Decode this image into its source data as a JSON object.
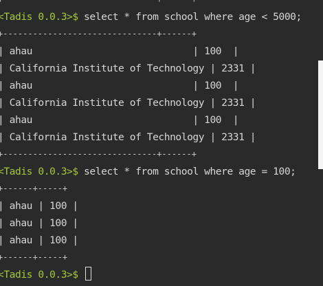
{
  "terminal": {
    "lines": [
      {
        "kind": "border",
        "text": "+-------------------------------+------+"
      },
      {
        "kind": "command",
        "prompt": "<Tadis 0.0.3>$",
        "text": " select * from school where age < 5000;"
      },
      {
        "kind": "border",
        "text": "+-------------------------------+------+"
      },
      {
        "kind": "row",
        "text": "| ahau                            | 100  |"
      },
      {
        "kind": "row",
        "text": "| California Institute of Technology | 2331 |"
      },
      {
        "kind": "row",
        "text": "| ahau                            | 100  |"
      },
      {
        "kind": "row",
        "text": "| California Institute of Technology | 2331 |"
      },
      {
        "kind": "row",
        "text": "| ahau                            | 100  |"
      },
      {
        "kind": "row",
        "text": "| California Institute of Technology | 2331 |"
      },
      {
        "kind": "border",
        "text": "+-------------------------------+------+"
      },
      {
        "kind": "command",
        "prompt": "<Tadis 0.0.3>$",
        "text": " select * from school where age = 100;"
      },
      {
        "kind": "border",
        "text": "+------+-----+"
      },
      {
        "kind": "row",
        "text": "| ahau | 100 |"
      },
      {
        "kind": "row",
        "text": "| ahau | 100 |"
      },
      {
        "kind": "row",
        "text": "| ahau | 100 |"
      },
      {
        "kind": "border",
        "text": "+------+-----+"
      },
      {
        "kind": "input",
        "prompt": "<Tadis 0.0.3>$",
        "text": " "
      }
    ]
  },
  "colors": {
    "background": "#2a2a2a",
    "prompt": "#a8c83a",
    "text": "#d6d6d6"
  }
}
